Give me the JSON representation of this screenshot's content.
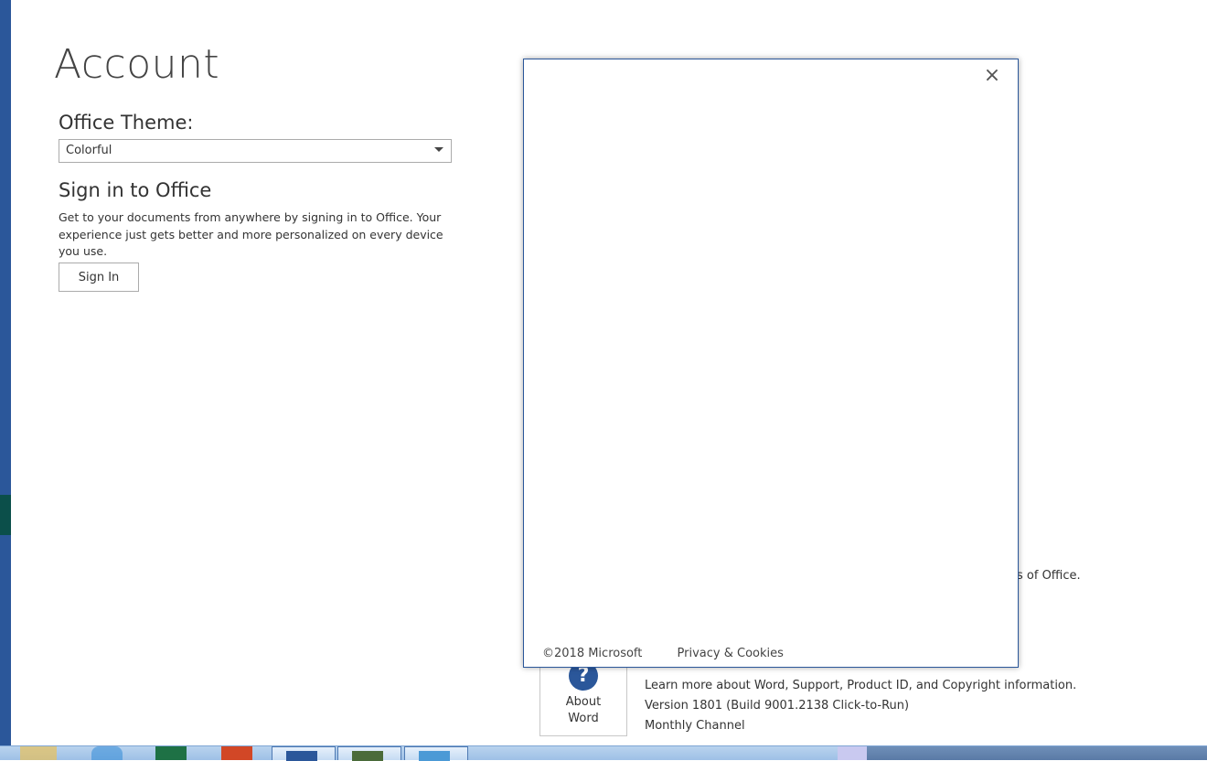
{
  "page": {
    "title": "Account"
  },
  "theme": {
    "label": "Office Theme:",
    "selected": "Colorful"
  },
  "signin": {
    "heading": "Sign in to Office",
    "description": "Get to your documents from anywhere by signing in to Office.  Your experience just gets better and more personalized on every device you use.",
    "button": "Sign In"
  },
  "background": {
    "office_text_fragment": "s of Office."
  },
  "about": {
    "tile_label_line1": "About",
    "tile_label_line2": "Word",
    "icon_glyph": "?",
    "info_line1": "Learn more about Word, Support, Product ID, and Copyright information.",
    "info_line2": "Version 1801 (Build 9001.2138 Click-to-Run)",
    "info_line3": "Monthly Channel"
  },
  "dialog": {
    "close_glyph": "×",
    "copyright": "©2018 Microsoft",
    "privacy": "Privacy & Cookies"
  },
  "colors": {
    "accent": "#2b579a",
    "sidebar_highlight": "#0b4f4a",
    "taskbar": "#b9d3ee"
  },
  "taskbar": {
    "icons": [
      "explorer-icon",
      "ie-icon",
      "excel-icon",
      "powerpoint-icon",
      "word-icon",
      "app-icon",
      "app-icon"
    ]
  }
}
